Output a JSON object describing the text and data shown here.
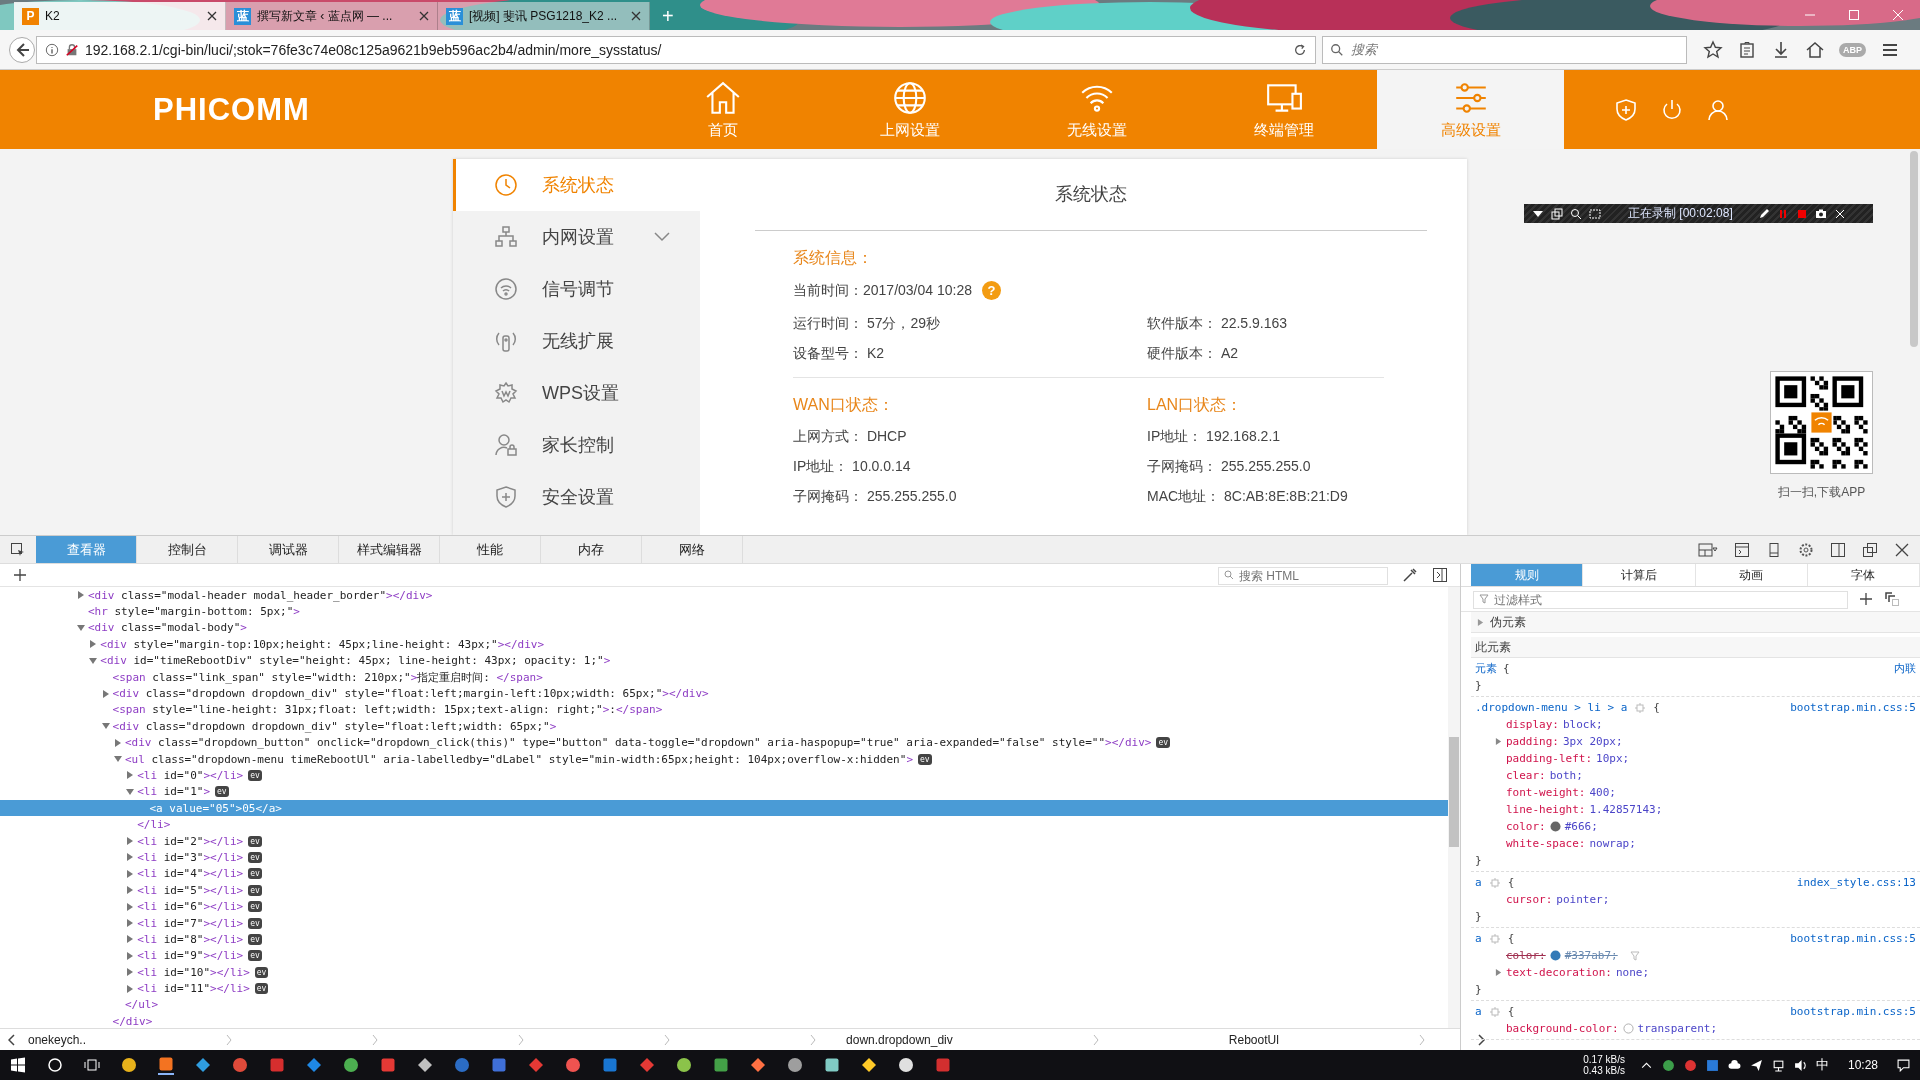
{
  "browser": {
    "tabs": [
      {
        "title": "K2",
        "favicon": "P",
        "selected": true
      },
      {
        "title": "撰写新文章 ‹ 蓝点网 — ...",
        "favicon": "蓝",
        "selected": false
      },
      {
        "title": "[视频] 斐讯 PSG1218_K2 ...",
        "favicon": "蓝",
        "selected": false
      }
    ],
    "new_tab": "+",
    "url": "192.168.2.1/cgi-bin/luci/;stok=76fe3c74e08c125a9621b9eb596ac2b4/admin/more_sysstatus/",
    "search": {
      "placeholder": "搜索"
    },
    "abp": "ABP"
  },
  "router": {
    "logo": "PHICOMM",
    "nav": [
      {
        "label": "首页",
        "selected": false
      },
      {
        "label": "上网设置",
        "selected": false
      },
      {
        "label": "无线设置",
        "selected": false
      },
      {
        "label": "终端管理",
        "selected": false
      },
      {
        "label": "高级设置",
        "selected": true
      }
    ],
    "sidebar": [
      {
        "label": "系统状态",
        "kind": "link",
        "selected": true
      },
      {
        "label": "内网设置",
        "kind": "submenu",
        "selected": false
      },
      {
        "label": "信号调节",
        "kind": "link",
        "selected": false
      },
      {
        "label": "无线扩展",
        "kind": "link",
        "selected": false
      },
      {
        "label": "WPS设置",
        "kind": "link",
        "selected": false
      },
      {
        "label": "家长控制",
        "kind": "link",
        "selected": false
      },
      {
        "label": "安全设置",
        "kind": "link",
        "selected": false
      }
    ],
    "status": {
      "title": "系统状态",
      "system": {
        "heading": "系统信息：",
        "current_time": {
          "label": "当前时间：",
          "value": "2017/03/04 10:28",
          "help": "?"
        },
        "fields": [
          {
            "label": "运行时间：",
            "value": "57分，29秒"
          },
          {
            "label": "软件版本：",
            "value": "22.5.9.163"
          },
          {
            "label": "设备型号：",
            "value": "K2"
          },
          {
            "label": "硬件版本：",
            "value": "A2"
          }
        ]
      },
      "wan": {
        "heading": "WAN口状态：",
        "fields": [
          {
            "label": "上网方式：",
            "value": "DHCP"
          },
          {
            "label": "IP地址：",
            "value": "10.0.0.14"
          },
          {
            "label": "子网掩码：",
            "value": "255.255.255.0"
          }
        ]
      },
      "lan": {
        "heading": "LAN口状态：",
        "fields": [
          {
            "label": "IP地址：",
            "value": "192.168.2.1"
          },
          {
            "label": "子网掩码：",
            "value": "255.255.255.0"
          },
          {
            "label": "MAC地址：",
            "value": "8C:AB:8E:8B:21:D9"
          }
        ]
      }
    },
    "qr_caption": "扫一扫,下载APP"
  },
  "recorder": {
    "status": "正在录制 [00:02:08]"
  },
  "devtools": {
    "tabs": [
      {
        "label": "查看器",
        "selected": true
      },
      {
        "label": "控制台",
        "selected": false
      },
      {
        "label": "调试器",
        "selected": false
      },
      {
        "label": "样式编辑器",
        "selected": false
      },
      {
        "label": "性能",
        "selected": false
      },
      {
        "label": "内存",
        "selected": false
      },
      {
        "label": "网络",
        "selected": false
      }
    ],
    "search": {
      "placeholder": "搜索 HTML"
    },
    "tree": [
      {
        "text": "<div class=\"modal-header modal_header_border\"></div>",
        "expanded": false,
        "selected": false
      },
      {
        "text": "<hr style=\"margin-bottom: 5px;\">",
        "selected": false
      },
      {
        "text": "<div class=\"modal-body\">",
        "expanded": true,
        "selected": false,
        "children": [
          {
            "text": "<div style=\"margin-top:10px;height: 45px;line-height: 43px;\"></div>",
            "expanded": false,
            "selected": false
          },
          {
            "text": "<div id=\"timeRebootDiv\" style=\"height: 45px; line-height: 43px; opacity: 1;\">",
            "expanded": true,
            "selected": false,
            "children": [
              {
                "text": "<span class=\"link_span\" style=\"width: 210px;\">指定重启时间: </span>",
                "selected": false
              },
              {
                "text": "<div class=\"dropdown dropdown_div\" style=\"float:left;margin-left:10px;width: 65px;\"></div>",
                "expanded": false,
                "selected": false
              },
              {
                "text": "<span style=\"line-height: 31px;float: left;width: 15px;text-align: right;\">:</span>",
                "selected": false
              },
              {
                "text": "<div class=\"dropdown dropdown_div\" style=\"float:left;width: 65px;\">",
                "expanded": true,
                "selected": false,
                "close": "</div>",
                "children": [
                  {
                    "text": "<div class=\"dropdown_button\" onclick=\"dropdown_click(this)\" type=\"button\" data-toggle=\"dropdown\" aria-haspopup=\"true\" aria-expanded=\"false\" style=\"\"></div>",
                    "expanded": false,
                    "selected": false,
                    "badge": "ev"
                  },
                  {
                    "text": "<ul class=\"dropdown-menu timeRebootUl\" aria-labelledby=\"dLabel\" style=\"min-width:65px;height: 104px;overflow-x:hidden\">",
                    "expanded": true,
                    "selected": false,
                    "badge": "ev",
                    "close": "</ul>",
                    "children": [
                      {
                        "text": "<li id=\"0\"></li>",
                        "expanded": false,
                        "selected": false,
                        "badge": "ev"
                      },
                      {
                        "text": "<li id=\"1\">",
                        "expanded": true,
                        "selected": false,
                        "badge": "ev",
                        "close": "</li>",
                        "children": [
                          {
                            "text": "<a value=\"05\">05</a>",
                            "selected": true
                          }
                        ]
                      },
                      {
                        "text": "<li id=\"2\"></li>",
                        "expanded": false,
                        "selected": false,
                        "badge": "ev"
                      },
                      {
                        "text": "<li id=\"3\"></li>",
                        "expanded": false,
                        "selected": false,
                        "badge": "ev"
                      },
                      {
                        "text": "<li id=\"4\"></li>",
                        "expanded": false,
                        "selected": false,
                        "badge": "ev"
                      },
                      {
                        "text": "<li id=\"5\"></li>",
                        "expanded": false,
                        "selected": false,
                        "badge": "ev"
                      },
                      {
                        "text": "<li id=\"6\"></li>",
                        "expanded": false,
                        "selected": false,
                        "badge": "ev"
                      },
                      {
                        "text": "<li id=\"7\"></li>",
                        "expanded": false,
                        "selected": false,
                        "badge": "ev"
                      },
                      {
                        "text": "<li id=\"8\"></li>",
                        "expanded": false,
                        "selected": false,
                        "badge": "ev"
                      },
                      {
                        "text": "<li id=\"9\"></li>",
                        "expanded": false,
                        "selected": false,
                        "badge": "ev"
                      },
                      {
                        "text": "<li id=\"10\"></li>",
                        "expanded": false,
                        "selected": false,
                        "badge": "ev"
                      },
                      {
                        "text": "<li id=\"11\"></li>",
                        "expanded": false,
                        "selected": false,
                        "badge": "ev"
                      }
                    ]
                  }
                ]
              }
            ]
          }
        ]
      }
    ],
    "breadcrumbs": [
      "onekeych..",
      "down.dropdown_div",
      "RebootUl"
    ],
    "style_tabs": [
      {
        "label": "规则",
        "selected": true
      },
      {
        "label": "计算后",
        "selected": false
      },
      {
        "label": "动画",
        "selected": false
      },
      {
        "label": "字体",
        "selected": false
      }
    ],
    "filter": {
      "placeholder": "过滤样式"
    },
    "pseudo": {
      "label": "伪元素",
      "expanded": false
    },
    "this_element": "此元素",
    "rules": [
      {
        "kind": "element",
        "selector": "元素",
        "open": "{",
        "close": "}",
        "source": "内联"
      },
      {
        "kind": "rule",
        "selector": ".dropdown-menu > li > a",
        "open": "{",
        "close": "}",
        "source": "bootstrap.min.css:5",
        "declarations": [
          {
            "kind": "plain",
            "prop": "display:",
            "value": "block;",
            "overridden": false
          },
          {
            "kind": "plain",
            "prop": "padding:",
            "value": "3px 20px;",
            "expandable": true,
            "overridden": false
          },
          {
            "kind": "plain",
            "prop": "padding-left:",
            "value": "10px;",
            "overridden": false
          },
          {
            "kind": "plain",
            "prop": "clear:",
            "value": "both;",
            "overridden": false
          },
          {
            "kind": "plain",
            "prop": "font-weight:",
            "value": "400;",
            "overridden": false
          },
          {
            "kind": "plain",
            "prop": "line-height:",
            "value": "1.42857143;",
            "overridden": false
          },
          {
            "kind": "color",
            "color": "#666666",
            "prop": "color:",
            "value": "#666;",
            "overridden": false
          },
          {
            "kind": "plain",
            "prop": "white-space:",
            "value": "nowrap;",
            "overridden": false
          }
        ]
      },
      {
        "kind": "rule",
        "selector": "a",
        "open": "{",
        "close": "}",
        "source": "index_style.css:13",
        "declarations": [
          {
            "kind": "plain",
            "prop": "cursor:",
            "value": "pointer;",
            "overridden": false
          }
        ]
      },
      {
        "kind": "rule",
        "selector": "a",
        "open": "{",
        "close": "}",
        "source": "bootstrap.min.css:5",
        "declarations": [
          {
            "kind": "color",
            "color": "#337ab7",
            "prop": "color:",
            "value": "#337ab7;",
            "overridden": true
          },
          {
            "kind": "plain",
            "prop": "text-decoration:",
            "value": "none;",
            "expandable": true,
            "overridden": false
          }
        ]
      },
      {
        "kind": "rule",
        "selector": "a",
        "open": "{",
        "source": "bootstrap.min.css:5",
        "declarations": [
          {
            "kind": "transparent",
            "prop": "background-color:",
            "value": "transparent;",
            "overridden": false
          }
        ]
      }
    ]
  },
  "taskbar": {
    "net_up": "0.17 kB/s",
    "net_down": "0.43 kB/s",
    "ime": "中",
    "time": "10:28"
  }
}
